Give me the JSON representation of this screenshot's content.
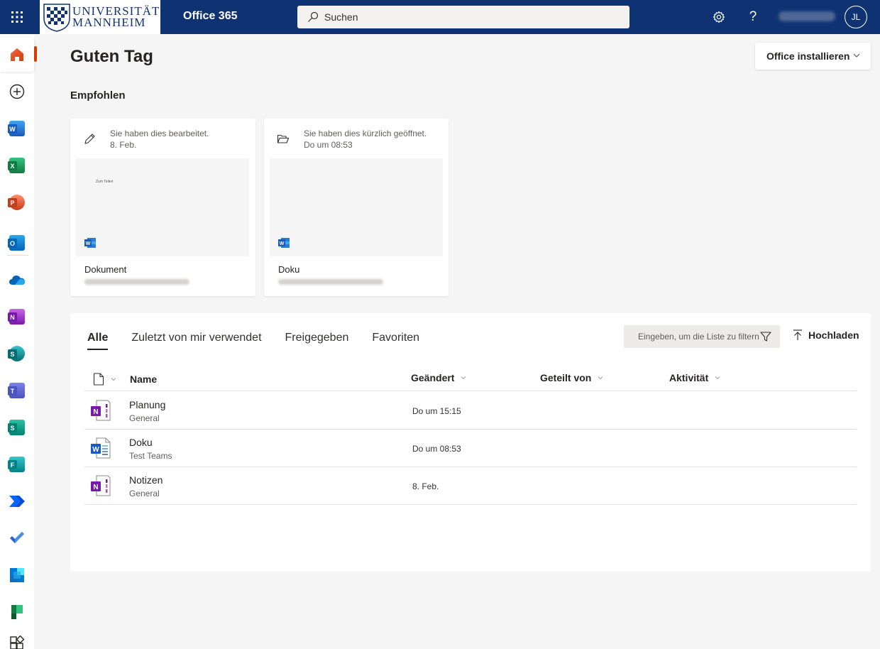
{
  "header": {
    "logo_line1": "UNIVERSITÄT",
    "logo_line2": "MANNHEIM",
    "app_name": "Office 365",
    "search_placeholder": "Suchen",
    "avatar_initials": "JL",
    "bar_color": "#0f3272"
  },
  "rail": {
    "items": [
      {
        "name": "home",
        "icon": "home-icon"
      },
      {
        "name": "create",
        "icon": "plus-circle-icon"
      },
      {
        "name": "word",
        "icon": "word-icon",
        "letter": "W",
        "color": "#185abd"
      },
      {
        "name": "excel",
        "icon": "excel-icon",
        "letter": "X",
        "color": "#107c41"
      },
      {
        "name": "powerpoint",
        "icon": "powerpoint-icon",
        "letter": "P",
        "color": "#c43e1c"
      },
      {
        "name": "outlook",
        "icon": "outlook-icon",
        "letter": "O",
        "color": "#0364b8"
      },
      {
        "name": "onedrive",
        "icon": "onedrive-icon"
      },
      {
        "name": "onenote",
        "icon": "onenote-icon",
        "letter": "N",
        "color": "#7719aa"
      },
      {
        "name": "sharepoint",
        "icon": "sharepoint-icon",
        "letter": "S",
        "color": "#036c70"
      },
      {
        "name": "teams",
        "icon": "teams-icon",
        "letter": "T",
        "color": "#4b53bc"
      },
      {
        "name": "sway",
        "icon": "sway-icon",
        "letter": "S",
        "color": "#008272"
      },
      {
        "name": "forms",
        "icon": "forms-icon",
        "letter": "F",
        "color": "#038387"
      },
      {
        "name": "power-automate",
        "icon": "power-automate-icon"
      },
      {
        "name": "todo",
        "icon": "todo-icon"
      },
      {
        "name": "stream",
        "icon": "stream-icon"
      },
      {
        "name": "planner",
        "icon": "planner-icon"
      },
      {
        "name": "all-apps",
        "icon": "all-apps-icon"
      }
    ]
  },
  "main": {
    "greeting": "Guten Tag",
    "install_button": "Office installieren",
    "recommended_title": "Empfohlen",
    "cards": [
      {
        "activity": "Sie haben dies bearbeitet.",
        "date": "8. Feb.",
        "title": "Dokument",
        "thumb_text": "Zum Teilen"
      },
      {
        "activity": "Sie haben dies kürzlich geöffnet.",
        "date": "Do um 08:53",
        "title": "Doku",
        "thumb_text": ""
      }
    ]
  },
  "files": {
    "tabs": [
      "Alle",
      "Zuletzt von mir verwendet",
      "Freigegeben",
      "Favoriten"
    ],
    "filter_placeholder": "Eingeben, um die Liste zu filtern",
    "upload_label": "Hochladen",
    "columns": {
      "name": "Name",
      "modified": "Geändert",
      "shared_by": "Geteilt von",
      "activity": "Aktivität"
    },
    "rows": [
      {
        "name": "Planung",
        "location": "General",
        "modified": "Do um 15:15",
        "type": "onenote"
      },
      {
        "name": "Doku",
        "location": "Test Teams",
        "modified": "Do um 08:53",
        "type": "word"
      },
      {
        "name": "Notizen",
        "location": "General",
        "modified": "8. Feb.",
        "type": "onenote"
      }
    ]
  },
  "colors": {
    "accent": "#d83b01",
    "word": "#185abd",
    "onenote": "#7719aa"
  }
}
